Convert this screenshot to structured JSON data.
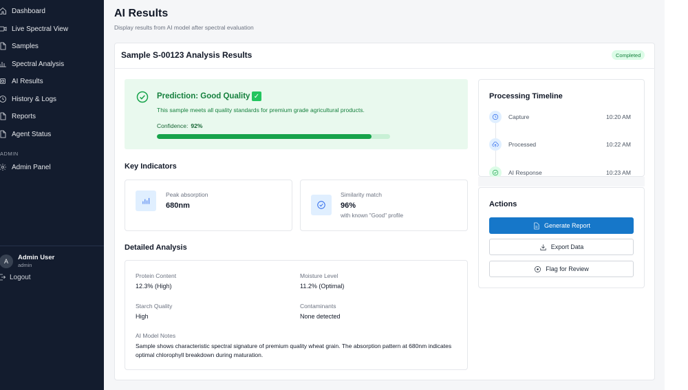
{
  "sidebar": {
    "items": [
      {
        "label": "Dashboard",
        "icon": "home-icon"
      },
      {
        "label": "Live Spectral View",
        "icon": "video-icon"
      },
      {
        "label": "Samples",
        "icon": "file-icon"
      },
      {
        "label": "Spectral Analysis",
        "icon": "bar-chart-icon"
      },
      {
        "label": "AI Results",
        "icon": "cpu-icon"
      },
      {
        "label": "History & Logs",
        "icon": "clock-icon"
      },
      {
        "label": "Reports",
        "icon": "file-icon"
      },
      {
        "label": "Agent Status",
        "icon": "file-icon"
      }
    ],
    "section_label": "ADMIN",
    "admin_item": {
      "label": "Admin Panel",
      "icon": "gear-icon"
    },
    "user": {
      "initial": "A",
      "name": "Admin User",
      "role": "admin"
    },
    "logout_label": "Logout"
  },
  "header": {
    "title": "AI Results",
    "subtitle": "Display results from AI model after spectral evaluation"
  },
  "result": {
    "title": "Sample S-00123 Analysis Results",
    "status": "Completed",
    "prediction_title": "Prediction: Good Quality",
    "prediction_check": "✓",
    "description": "This sample meets all quality standards for premium grade agricultural products.",
    "confidence_label": "Confidence:",
    "confidence_value": "92%",
    "confidence": 0.92
  },
  "indicators": {
    "heading": "Key Indicators",
    "items": [
      {
        "label": "Peak absorption",
        "value": "680nm",
        "sub": "",
        "icon": "bar-chart-icon"
      },
      {
        "label": "Similarity match",
        "value": "96%",
        "sub": "with known \"Good\" profile",
        "icon": "check-circle-icon"
      }
    ]
  },
  "detailed": {
    "heading": "Detailed Analysis",
    "fields": [
      {
        "label": "Protein Content",
        "value": "12.3% (High)"
      },
      {
        "label": "Moisture Level",
        "value": "11.2% (Optimal)"
      },
      {
        "label": "Starch Quality",
        "value": "High"
      },
      {
        "label": "Contaminants",
        "value": "None detected"
      }
    ],
    "notes_label": "AI Model Notes",
    "notes": "Sample shows characteristic spectral signature of premium quality wheat grain. The absorption pattern at 680nm indicates optimal chlorophyll breakdown during maturation."
  },
  "timeline": {
    "title": "Processing Timeline",
    "events": [
      {
        "label": "Capture",
        "time": "10:20 AM",
        "icon": "clock-icon"
      },
      {
        "label": "Processed",
        "time": "10:22 AM",
        "icon": "cloud-upload-icon"
      },
      {
        "label": "AI Response",
        "time": "10:23 AM",
        "icon": "check-circle-icon"
      }
    ]
  },
  "actions": {
    "title": "Actions",
    "generate_label": "Generate Report",
    "export_label": "Export Data",
    "flag_label": "Flag for Review"
  },
  "colors": {
    "sidebar_bg": "#131c2e",
    "success": "#16a34a",
    "primary": "#1677c9"
  }
}
